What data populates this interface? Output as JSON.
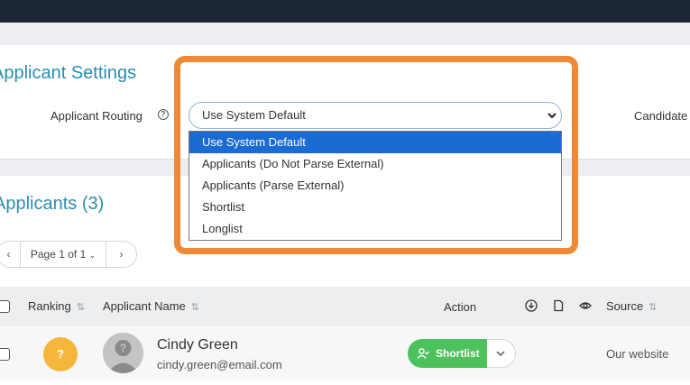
{
  "settings": {
    "title": "Applicant Settings",
    "routing_label": "Applicant Routing",
    "routing_selected": "Use System Default",
    "candidate_label": "Candidate",
    "routing_options": [
      "Use System Default",
      "Applicants (Do Not Parse External)",
      "Applicants (Parse External)",
      "Shortlist",
      "Longlist"
    ]
  },
  "applicants": {
    "title": "Applicants (3)",
    "pager": {
      "prev": "‹",
      "page_label": "Page 1 of 1",
      "next": "›"
    },
    "columns": {
      "ranking": "Ranking",
      "name": "Applicant Name",
      "action": "Action",
      "source": "Source"
    },
    "rows": [
      {
        "rank": "?",
        "name": "Cindy Green",
        "email": "cindy.green@email.com",
        "action": "Shortlist",
        "source": "Our website"
      }
    ]
  },
  "colors": {
    "accent": "#2a8db0",
    "highlight": "#ee8a35",
    "shortlist": "#4cc15c",
    "rank_badge": "#f5b63c",
    "selected_option": "#1b6bd4"
  },
  "icons": [
    "help-icon",
    "chevron-down-icon",
    "sort-icon",
    "download-icon",
    "document-icon",
    "eye-icon",
    "user-check-icon",
    "avatar-placeholder-icon"
  ]
}
